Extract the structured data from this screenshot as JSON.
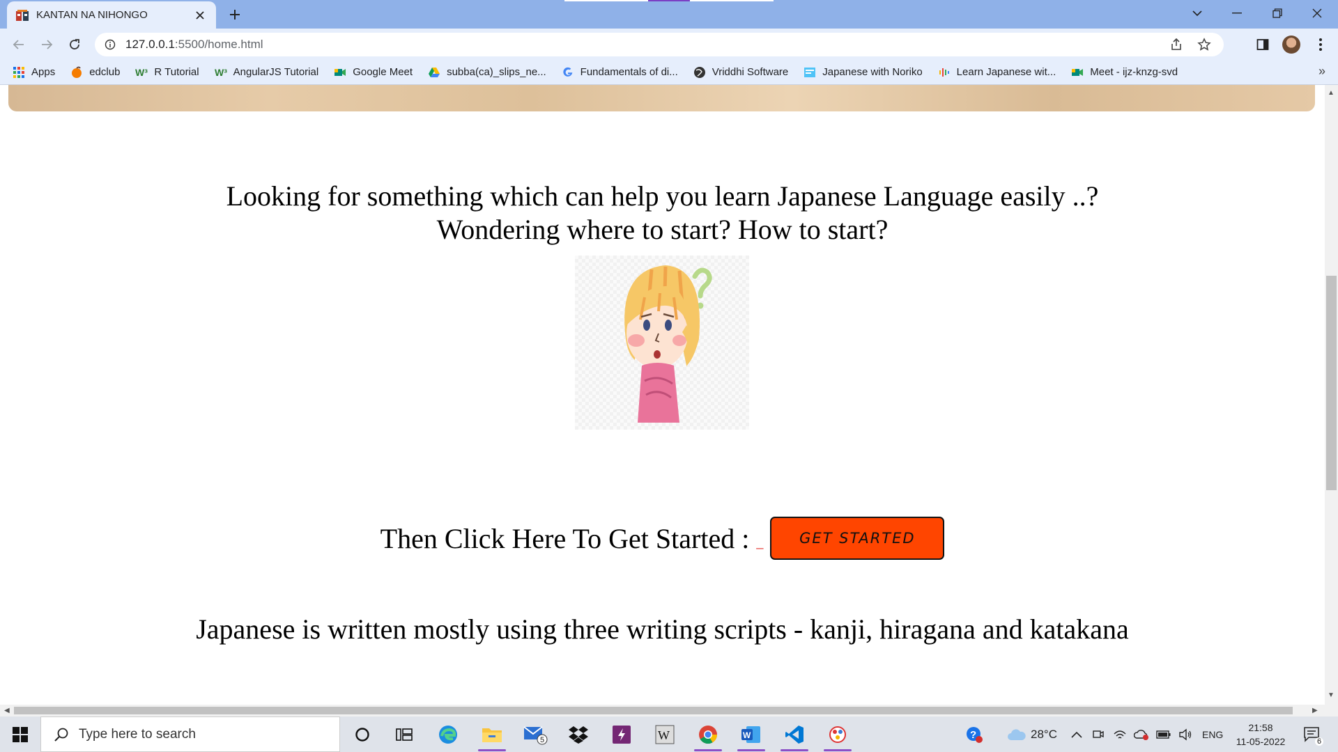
{
  "browser": {
    "tab_title": "KANTAN NA NIHONGO",
    "url_host": "127.0.0.1",
    "url_path": ":5500/home.html"
  },
  "bookmarks": [
    {
      "label": "Apps",
      "icon": "apps-grid-icon",
      "color": "#1a73e8"
    },
    {
      "label": "edclub",
      "icon": "edclub-icon",
      "color": "#f57c00"
    },
    {
      "label": "R Tutorial",
      "icon": "w3schools-icon",
      "color": "#2e7d32"
    },
    {
      "label": "AngularJS Tutorial",
      "icon": "w3schools-icon",
      "color": "#2e7d32"
    },
    {
      "label": "Google Meet",
      "icon": "google-meet-icon",
      "color": "#00897b"
    },
    {
      "label": "subba(ca)_slips_ne...",
      "icon": "google-drive-icon",
      "color": "#fbbc04"
    },
    {
      "label": "Fundamentals of di...",
      "icon": "google-icon",
      "color": "#4285f4"
    },
    {
      "label": "Vriddhi Software",
      "icon": "globe-icon",
      "color": "#333333"
    },
    {
      "label": "Japanese with Noriko",
      "icon": "noriko-icon",
      "color": "#4fc3f7"
    },
    {
      "label": "Learn Japanese wit...",
      "icon": "podcast-icon",
      "color": "#f4b400"
    },
    {
      "label": "Meet - ijz-knzg-svd",
      "icon": "google-meet-icon",
      "color": "#00897b"
    }
  ],
  "page": {
    "headline_line1": "Looking for something which can help you learn Japanese Language easily ..?",
    "headline_line2": "Wondering where to start? How to start?",
    "cta_text": "Then Click Here To Get Started :",
    "cta_dash": "_",
    "button_label": "GET STARTED",
    "scripts_line": "Japanese is written mostly using three writing scripts - kanji, hiragana and katakana",
    "button_color": "#ff4500"
  },
  "taskbar": {
    "search_placeholder": "Type here to search",
    "mail_badge": "5",
    "temperature": "28°C",
    "language": "ENG",
    "time": "21:58",
    "date": "11-05-2022",
    "notification_count": "6"
  }
}
